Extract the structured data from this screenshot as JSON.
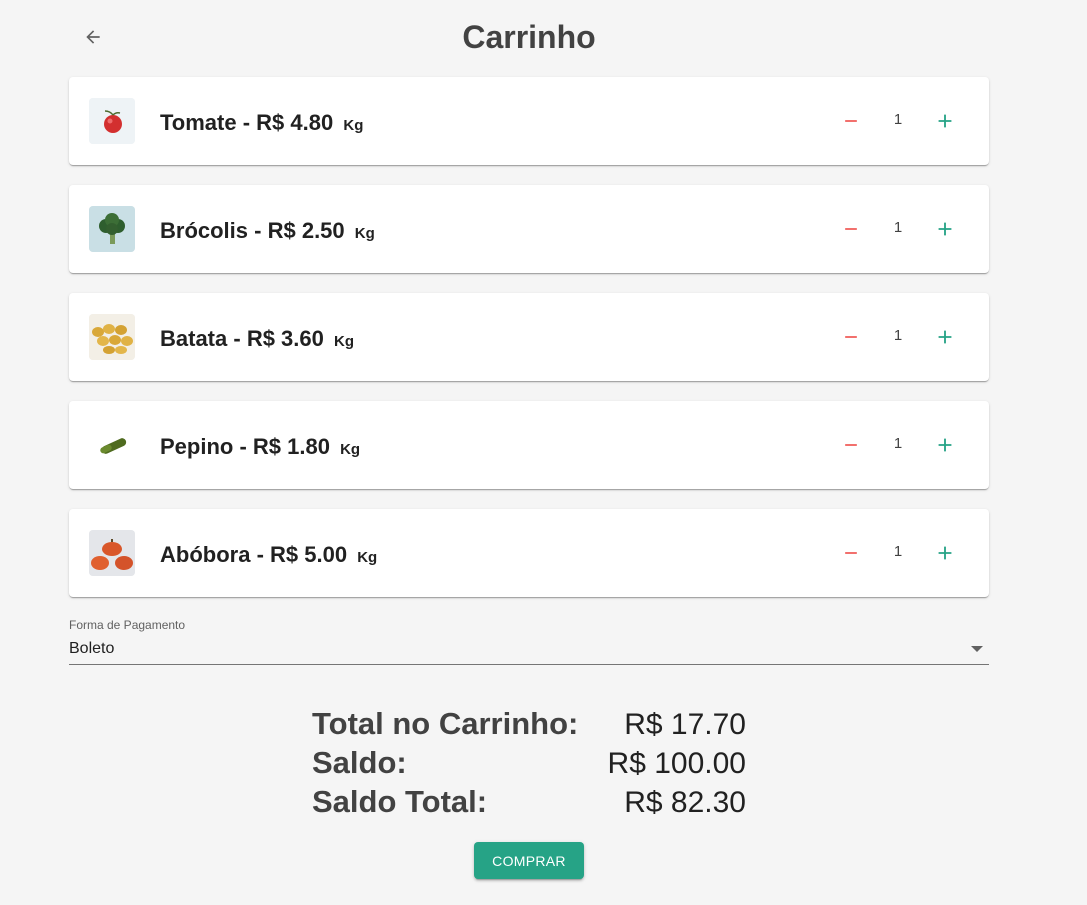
{
  "header": {
    "title": "Carrinho",
    "back_icon": "arrow-left-icon"
  },
  "cart": {
    "items": [
      {
        "name": "Tomate",
        "price_text": "- R$ 4.80",
        "unit": "Kg",
        "quantity": "1",
        "image": "tomato"
      },
      {
        "name": "Brócolis",
        "price_text": "- R$ 2.50",
        "unit": "Kg",
        "quantity": "1",
        "image": "broccoli"
      },
      {
        "name": "Batata",
        "price_text": "- R$ 3.60",
        "unit": "Kg",
        "quantity": "1",
        "image": "potatoes"
      },
      {
        "name": "Pepino",
        "price_text": "- R$ 1.80",
        "unit": "Kg",
        "quantity": "1",
        "image": "cucumber"
      },
      {
        "name": "Abóbora",
        "price_text": "- R$ 5.00",
        "unit": "Kg",
        "quantity": "1",
        "image": "pumpkin"
      }
    ],
    "minus_icon": "minus-icon",
    "plus_icon": "plus-icon",
    "colors": {
      "minus": "#ef5350",
      "plus": "#26a386"
    }
  },
  "payment": {
    "label": "Forma de Pagamento",
    "selected": "Boleto",
    "dropdown_icon": "caret-down-icon"
  },
  "summary": {
    "total_label": "Total no Carrinho:",
    "total_value": "R$ 17.70",
    "balance_label": "Saldo:",
    "balance_value": "R$ 100.00",
    "final_label": "Saldo Total:",
    "final_value": "R$ 82.30"
  },
  "actions": {
    "buy_label": "COMPRAR",
    "buy_color": "#26a386"
  }
}
